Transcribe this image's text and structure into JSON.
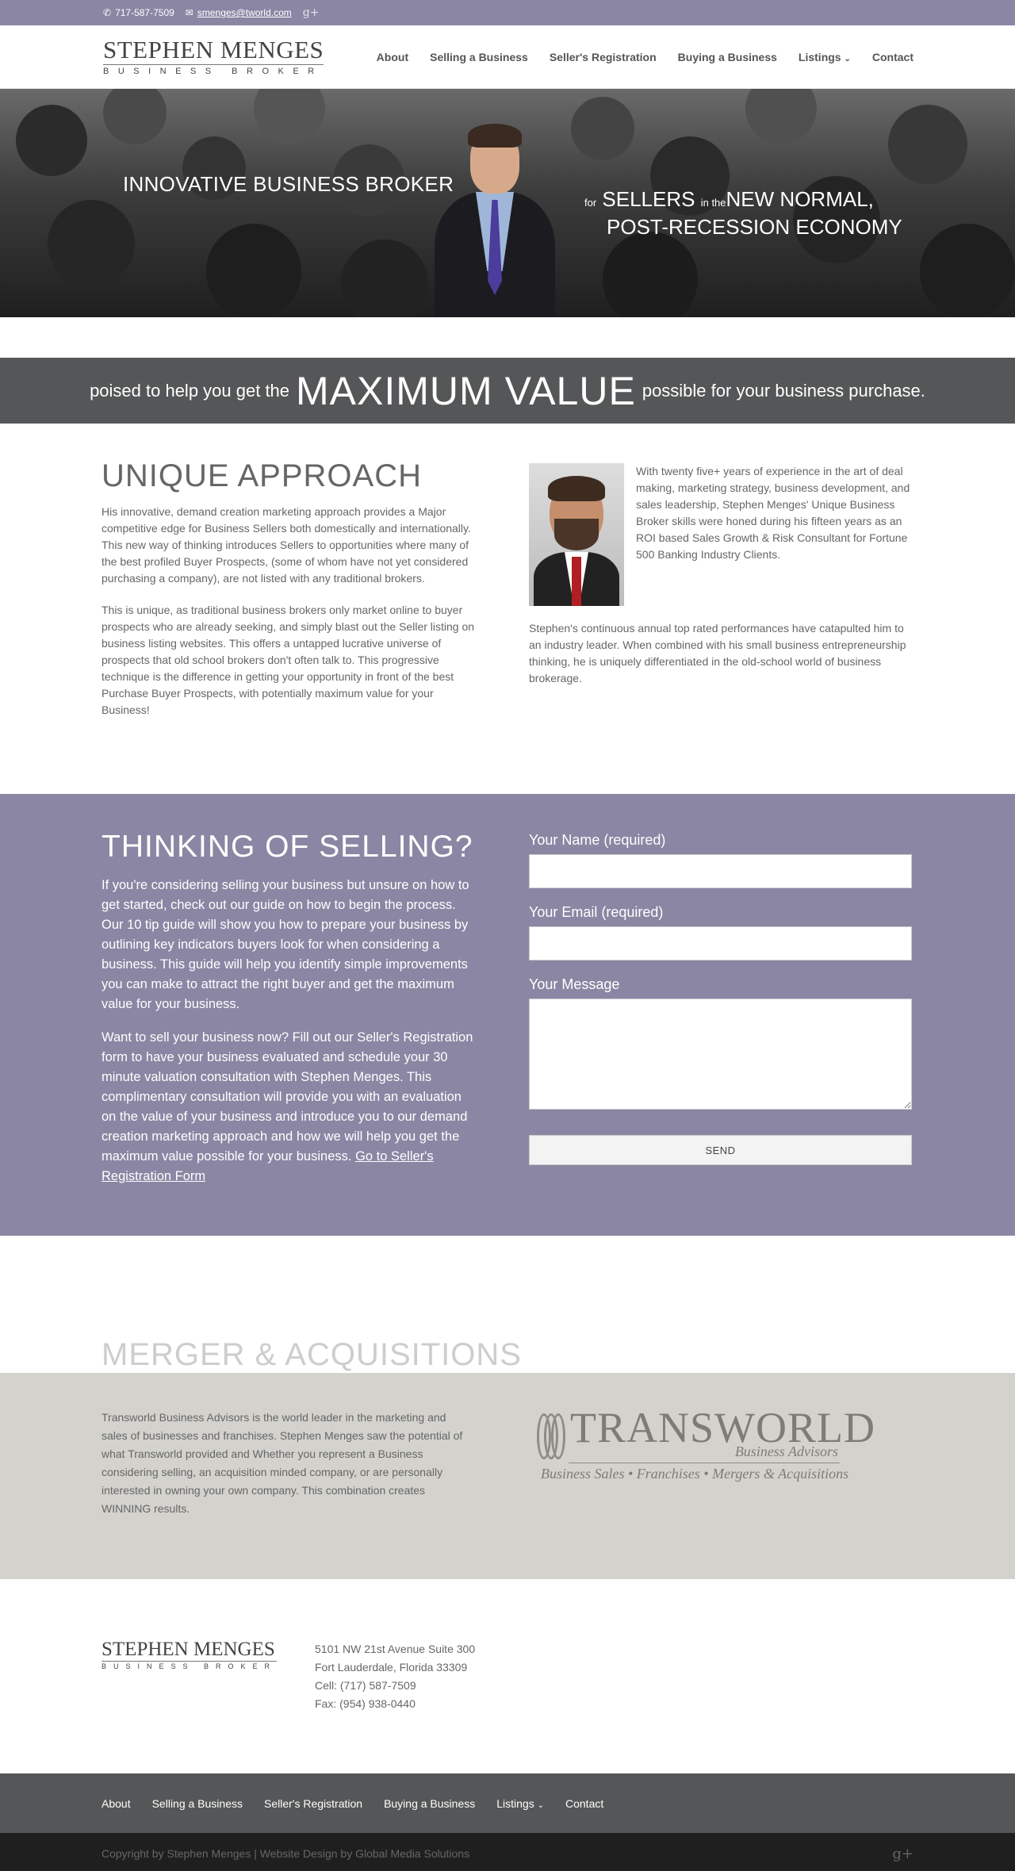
{
  "topbar": {
    "phone": "717-587-7509",
    "email": "smenges@tworld.com",
    "social_icon": "google-plus-icon"
  },
  "header": {
    "logo_line1": "STEPHEN MENGES",
    "logo_line2": "BUSINESS BROKER",
    "nav": [
      "About",
      "Selling a Business",
      "Seller's Registration",
      "Buying a Business",
      "Listings",
      "Contact"
    ]
  },
  "hero": {
    "left_text": "INNOVATIVE BUSINESS BROKER",
    "right_small1": "for",
    "right_big1": "SELLERS",
    "right_small2": "in the",
    "right_big2": "NEW NORMAL,",
    "right_line2": "POST-RECESSION ECONOMY"
  },
  "band": {
    "before": "poised to help you get the",
    "big": "MAXIMUM VALUE",
    "after": "possible for your business purchase."
  },
  "unique": {
    "title": "UNIQUE APPROACH",
    "p1": "His innovative, demand creation marketing approach provides a Major competitive edge for Business Sellers both domestically and internationally. This new way of thinking introduces Sellers to opportunities where many of the best profiled Buyer Prospects, (some of whom have not yet considered purchasing a company), are not listed with any traditional brokers.",
    "p2": "This is unique, as traditional business brokers only market online to buyer prospects who are already seeking, and simply blast out the Seller listing on business listing websites. This offers a untapped lucrative universe of prospects that old school brokers don't often talk to. This progressive technique is the difference in getting your opportunity in front of the best Purchase Buyer Prospects, with potentially maximum value for your Business!",
    "bio1": "With twenty five+ years of experience in the art of deal making, marketing strategy, business development, and sales leadership, Stephen Menges' Unique Business Broker skills were honed during his fifteen years as an ROI based Sales Growth & Risk Consultant for Fortune 500 Banking Industry Clients.",
    "bio2": "Stephen's continuous annual top rated performances have catapulted him to an industry leader. When combined with his small business entrepreneurship thinking, he is uniquely differentiated in the old-school world of business brokerage."
  },
  "selling": {
    "title": "THINKING OF SELLING?",
    "p1": "If you're considering selling your business but unsure on how to get started, check out our guide on how to begin the process. Our 10 tip guide will show you how to prepare your business by outlining key indicators buyers look for when considering a business. This guide will help you identify simple improvements you can make to attract the right buyer and get the maximum value for your business.",
    "p2": "Want to sell your business now? Fill out our Seller's Registration form to have your business evaluated and schedule your 30 minute valuation consultation with Stephen Menges. This complimentary consultation will provide you with an evaluation on the value of your business and introduce you to our demand creation marketing approach and how we will help you get the maximum value possible for your business.",
    "link": "Go to Seller's Registration Form",
    "form": {
      "name_label": "Your Name (required)",
      "email_label": "Your Email (required)",
      "message_label": "Your Message",
      "send": "SEND"
    }
  },
  "merger": {
    "title": "MERGER & ACQUISITIONS",
    "text": "Transworld Business Advisors is the world leader in the marketing and sales of businesses and franchises. Stephen Menges saw the potential of what Transworld provided and Whether you represent a Business considering selling, an acquisition minded company, or are personally interested in owning your own company. This combination creates WINNING results.",
    "logo_name": "TRANSWORLD",
    "logo_sub": "Business Advisors",
    "logo_tag": "Business Sales • Franchises • Mergers & Acquisitions"
  },
  "footer": {
    "logo_line1": "STEPHEN MENGES",
    "logo_line2": "BUSINESS BROKER",
    "address1": "5101 NW 21st Avenue Suite 300",
    "address2": "Fort Lauderdale, Florida 33309",
    "cell": "Cell: (717) 587-7509",
    "fax": "Fax: (954) 938-0440",
    "nav": [
      "About",
      "Selling a Business",
      "Seller's Registration",
      "Buying a Business",
      "Listings",
      "Contact"
    ],
    "copyright": "Copyright by Stephen Menges | Website Design by Global Media Solutions"
  }
}
